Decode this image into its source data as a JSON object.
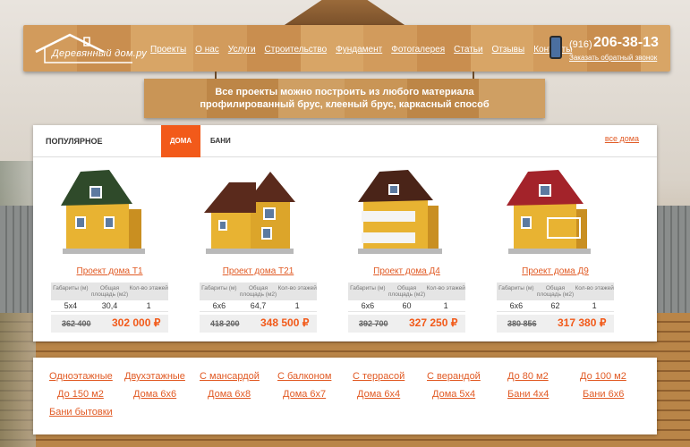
{
  "logo": {
    "text": "Деревянный дом.ру"
  },
  "nav": [
    "Проекты",
    "О нас",
    "Услуги",
    "Строительство",
    "Фундамент",
    "Фотогалерея",
    "Статьи",
    "Отзывы",
    "Контакты"
  ],
  "contact": {
    "code": "(916)",
    "phone": "206-38-13",
    "callback": "Заказать обратный звонок"
  },
  "banner": {
    "line1": "Все проекты можно построить из любого материала",
    "line2": "профилированный брус, клееный брус, каркасный способ"
  },
  "tabs": {
    "popular": "ПОПУЛЯРНОЕ",
    "houses": "ДОМА",
    "baths": "БАНИ",
    "all": "все дома"
  },
  "spec_headers": [
    "Габариты (м)",
    "Общая площадь (м2)",
    "Кол-во этажей"
  ],
  "projects": [
    {
      "name": "Проект дома Т1",
      "size": "5x4",
      "area": "30,4",
      "floors": "1",
      "old_price": "362 400",
      "price": "302 000 ₽",
      "roof": "#2f4a2a"
    },
    {
      "name": "Проект дома Т21",
      "size": "6x6",
      "area": "64,7",
      "floors": "1",
      "old_price": "418 200",
      "price": "348 500 ₽",
      "roof": "#5a2a1c"
    },
    {
      "name": "Проект дома Д4",
      "size": "6x6",
      "area": "60",
      "floors": "1",
      "old_price": "392 700",
      "price": "327 250 ₽",
      "roof": "#4a2418"
    },
    {
      "name": "Проект дома Д9",
      "size": "6x6",
      "area": "62",
      "floors": "1",
      "old_price": "380 856",
      "price": "317 380 ₽",
      "roof": "#a3232a"
    }
  ],
  "filters": [
    "Одноэтажные",
    "Двухэтажные",
    "С мансардой",
    "С балконом",
    "С террасой",
    "С верандой",
    "До 80 м2",
    "До 100 м2",
    "До 150 м2",
    "Дома 6x6",
    "Дома 6x8",
    "Дома 6x7",
    "Дома 6x4",
    "Дома 5x4",
    "Бани 4x4",
    "Бани 6x6",
    "Бани бытовки"
  ]
}
